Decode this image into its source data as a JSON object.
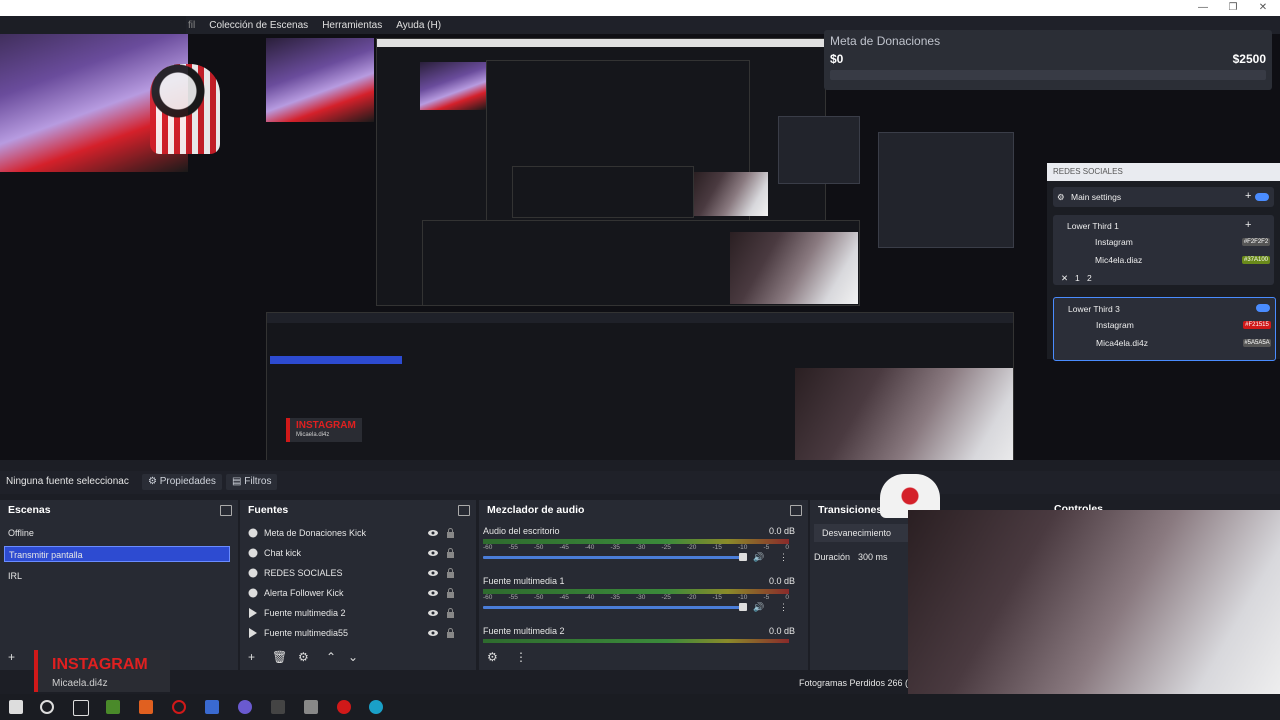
{
  "menu": [
    "fil",
    "Colección de Escenas",
    "Herramientas",
    "Ayuda (H)"
  ],
  "window_controls": [
    "—",
    "❐",
    "✕"
  ],
  "donations": {
    "title": "Meta de Donaciones",
    "current": "$0",
    "goal": "$2500"
  },
  "redes": {
    "header": "REDES SOCIALES",
    "main_settings": "Main settings",
    "lower_third_1": "Lower Third 1",
    "lower_third_3": "Lower Third 3",
    "lt1_items": [
      {
        "label": "Instagram",
        "chip": "#F2F2F2"
      },
      {
        "label": "Mic4ela.diaz",
        "chip": "#37A100"
      }
    ],
    "lt3_items": [
      {
        "label": "Instagram",
        "chip": "#F21515"
      },
      {
        "label": "Mica4ela.di4z",
        "chip": "#5A5A5A"
      }
    ],
    "lt1_controls": [
      "✕",
      "1",
      "2"
    ]
  },
  "source_bar": {
    "no_source": "Ninguna fuente seleccionac",
    "properties": "Propiedades",
    "filters": "Filtros"
  },
  "scenes": {
    "title": "Escenas",
    "items": [
      "Offline",
      "Transmitir pantalla",
      "IRL"
    ],
    "selected_index": 1
  },
  "sources": {
    "title": "Fuentes",
    "items": [
      {
        "label": "Meta de Donaciones Kick",
        "icon": "globe-icon"
      },
      {
        "label": "Chat kick",
        "icon": "globe-icon"
      },
      {
        "label": "REDES SOCIALES",
        "icon": "globe-icon"
      },
      {
        "label": "Alerta Follower Kick",
        "icon": "globe-icon"
      },
      {
        "label": "Fuente multimedia 2",
        "icon": "play-icon"
      },
      {
        "label": "Fuente multimedia55",
        "icon": "play-icon"
      }
    ]
  },
  "mixer": {
    "title": "Mezclador de audio",
    "ticks": [
      "-60",
      "-55",
      "-50",
      "-45",
      "-40",
      "-35",
      "-30",
      "-25",
      "-20",
      "-15",
      "-10",
      "-5",
      "0"
    ],
    "channels": [
      {
        "name": "Audio del escritorio",
        "db": "0.0 dB"
      },
      {
        "name": "Fuente multimedia 1",
        "db": "0.0 dB"
      },
      {
        "name": "Fuente multimedia 2",
        "db": "0.0 dB"
      }
    ]
  },
  "transitions": {
    "title": "Transiciones",
    "selected": "Desvanecimiento",
    "duration_label": "Duración",
    "duration_value": "300 ms"
  },
  "controls": {
    "title": "Controles"
  },
  "instagram": {
    "title": "INSTAGRAM",
    "handle": "Micaela.di4z"
  },
  "status": {
    "dropped_frames": "Fotogramas Perdidos 266 ("
  },
  "taskbar_icons": [
    "windows-icon",
    "search-icon",
    "task-view-icon",
    "minecraft-icon",
    "fire-icon",
    "opera-icon",
    "screenshot-icon",
    "obs-icon",
    "sharex-icon",
    "files-icon",
    "record-icon",
    "edge-icon"
  ],
  "colors": {
    "accent": "#2d4bd1",
    "instagram_red": "#e02020",
    "toggle_blue": "#4a8cff"
  }
}
